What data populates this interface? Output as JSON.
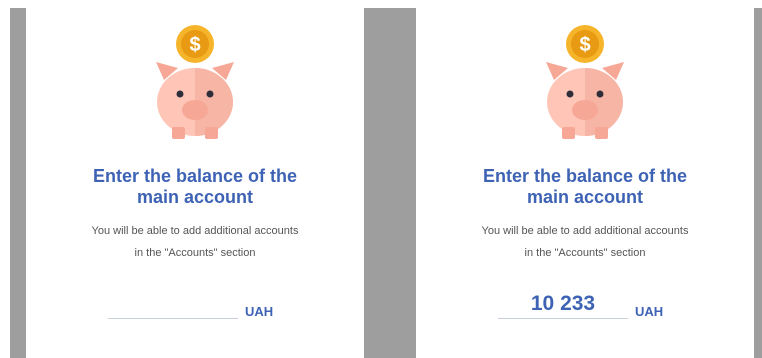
{
  "screens": [
    {
      "title_line1": "Enter the balance of the",
      "title_line2": "main account",
      "subtitle_line1": "You will be able to add additional accounts",
      "subtitle_line2": "in the \"Accounts\" section",
      "balance_value": "",
      "currency": "UAH"
    },
    {
      "title_line1": "Enter the balance of the",
      "title_line2": "main account",
      "subtitle_line1": "You will be able to add additional accounts",
      "subtitle_line2": "in the \"Accounts\" section",
      "balance_value": "10 233",
      "currency": "UAH"
    }
  ],
  "icons": {
    "illustration": "piggy-bank-with-coin-icon",
    "coin_symbol": "$"
  },
  "colors": {
    "accent": "#3e63b4",
    "pig": "#ffc5b7",
    "pig_dark": "#f7a795",
    "coin": "#f6b42a",
    "coin_dark": "#e79a12",
    "separator": "#9e9e9e"
  }
}
